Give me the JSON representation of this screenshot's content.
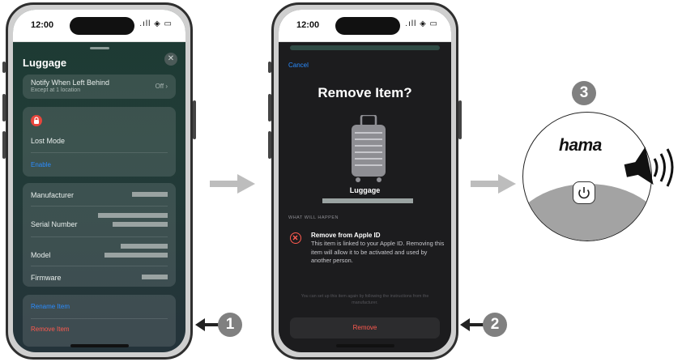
{
  "colors": {
    "accent_blue": "#2b8cff",
    "destructive_red": "#ff5a4f",
    "step_badge": "#808080"
  },
  "status_bar": {
    "time": "12:00",
    "icons": ".ıll ◈ ▭"
  },
  "phone1": {
    "sheet_title": "Luggage",
    "close_icon": "close-icon",
    "notify": {
      "title": "Notify When Left Behind",
      "subtitle": "Except at 1 location",
      "value": "Off ›"
    },
    "lost_mode": {
      "title": "Lost Mode",
      "link": "Enable"
    },
    "info_rows": [
      {
        "label": "Manufacturer"
      },
      {
        "label": "Serial Number"
      },
      {
        "label": "Model"
      },
      {
        "label": "Firmware"
      }
    ],
    "actions": {
      "rename": "Rename Item",
      "remove": "Remove Item"
    }
  },
  "phone2": {
    "cancel": "Cancel",
    "title": "Remove Item?",
    "item_name": "Luggage",
    "section_label": "WHAT WILL HAPPEN",
    "warning": {
      "title": "Remove from Apple ID",
      "body": "This item is linked to your Apple ID. Removing this item will allow it to be activated and used by another person."
    },
    "footnote": "You can set up this item again by following the instructions from the manufacturer.",
    "remove_button": "Remove"
  },
  "steps": {
    "one": "1",
    "two": "2",
    "three": "3"
  },
  "device": {
    "brand": "hama"
  }
}
